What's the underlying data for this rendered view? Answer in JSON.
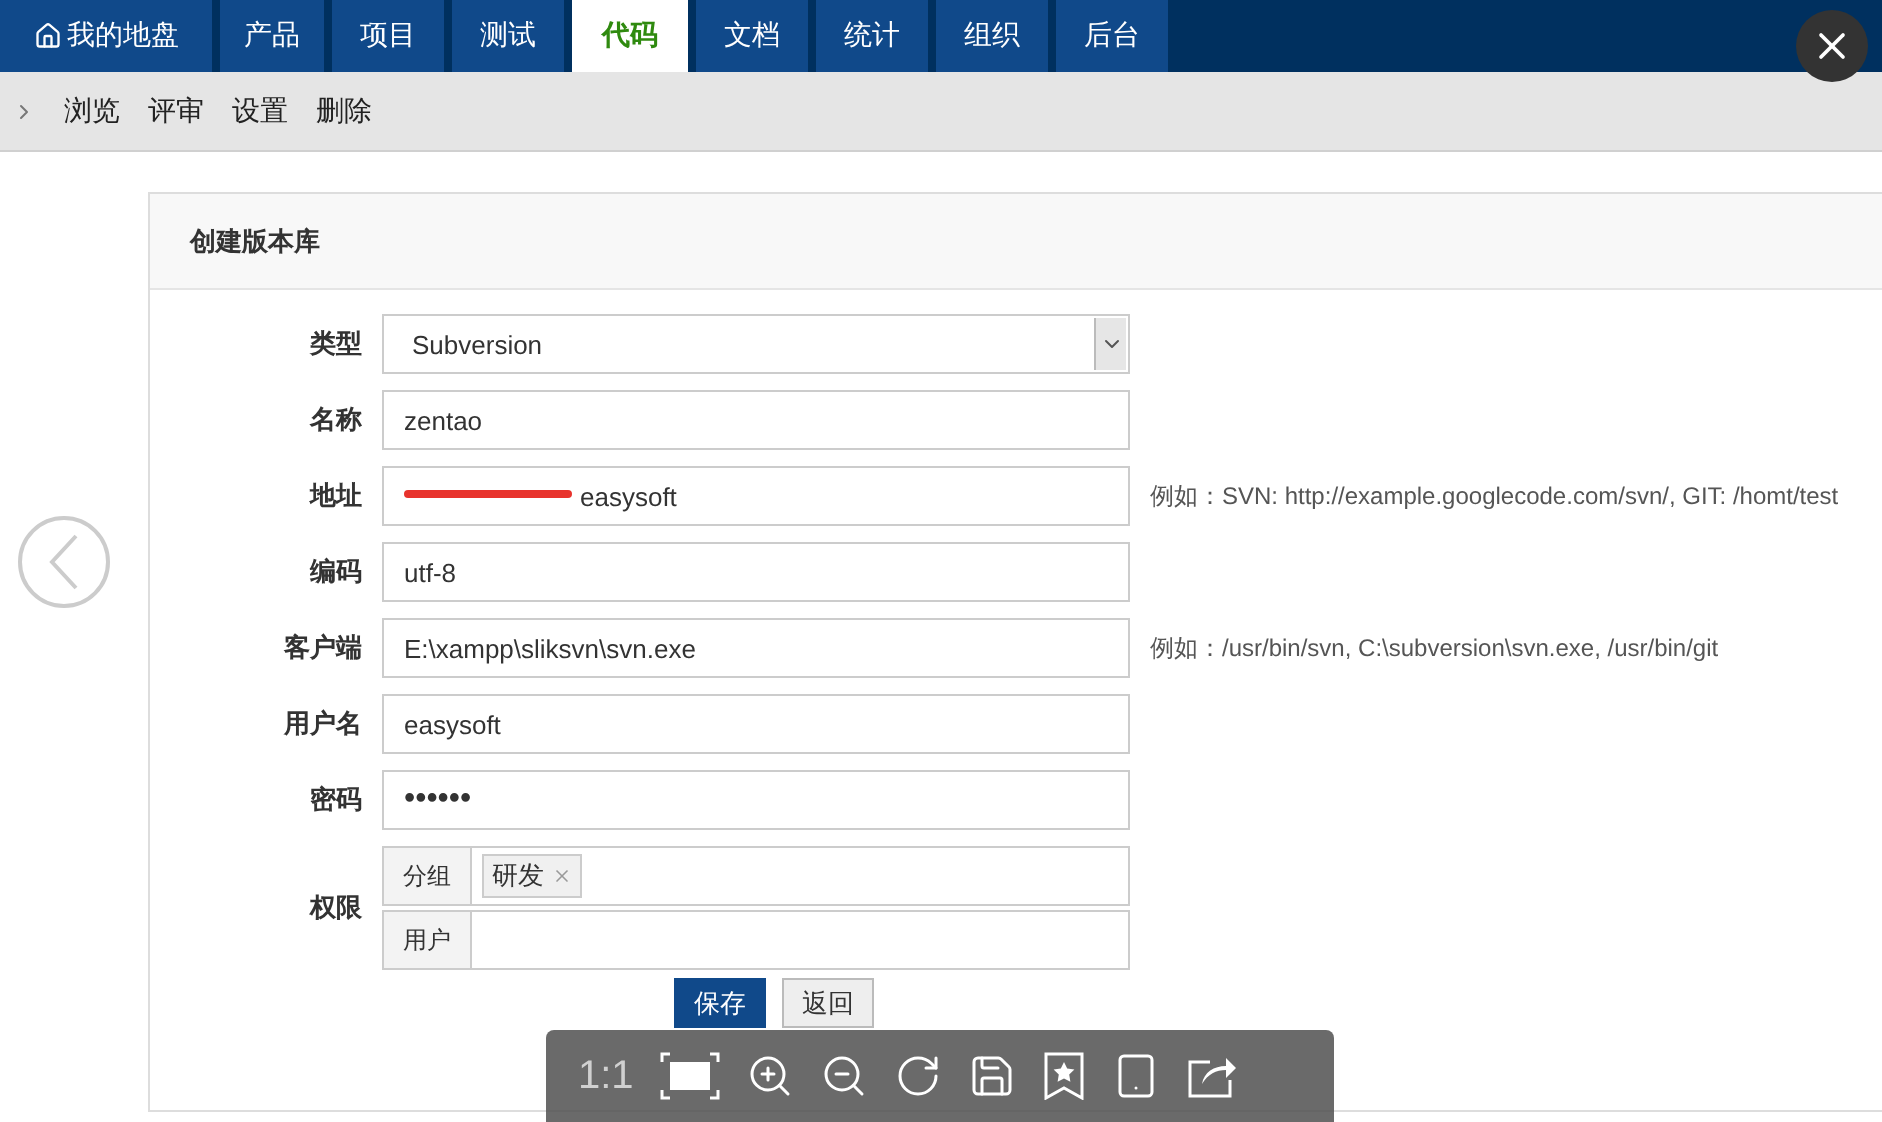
{
  "nav": {
    "tabs": [
      {
        "label": "我的地盘",
        "kind": "home",
        "selected": false
      },
      {
        "label": "产品",
        "kind": "plain",
        "selected": false
      },
      {
        "label": "项目",
        "kind": "plain",
        "selected": false
      },
      {
        "label": "测试",
        "kind": "plain",
        "selected": false
      },
      {
        "label": "代码",
        "kind": "plain",
        "selected": true
      },
      {
        "label": "文档",
        "kind": "plain",
        "selected": false
      },
      {
        "label": "统计",
        "kind": "plain",
        "selected": false
      },
      {
        "label": "组织",
        "kind": "plain",
        "selected": false
      },
      {
        "label": "后台",
        "kind": "plain",
        "selected": false
      }
    ]
  },
  "subnav": {
    "items": [
      "浏览",
      "评审",
      "设置",
      "删除"
    ]
  },
  "form": {
    "title": "创建版本库",
    "fields": [
      {
        "label": "类型",
        "kind": "select",
        "value": "Subversion"
      },
      {
        "label": "名称",
        "kind": "text",
        "value": "zentao"
      },
      {
        "label": "地址",
        "kind": "redacted",
        "value": "easysoft",
        "hint": "例如：SVN: http://example.googlecode.com/svn/, GIT: /homt/test"
      },
      {
        "label": "编码",
        "kind": "text",
        "value": "utf-8"
      },
      {
        "label": "客户端",
        "kind": "text",
        "value": "E:\\xampp\\sliksvn\\svn.exe",
        "hint": "例如：/usr/bin/svn, C:\\subversion\\svn.exe, /usr/bin/git"
      },
      {
        "label": "用户名",
        "kind": "text",
        "value": "easysoft"
      },
      {
        "label": "密码",
        "kind": "password",
        "value": "••••••"
      },
      {
        "label": "权限",
        "kind": "permissions",
        "rows": [
          {
            "label": "分组",
            "tags": [
              "研发"
            ]
          },
          {
            "label": "用户",
            "tags": []
          }
        ]
      }
    ],
    "buttons": [
      {
        "label": "保存",
        "kind": "primary"
      },
      {
        "label": "返回",
        "kind": "default"
      }
    ]
  },
  "viewer": {
    "zoom_label": "1:1"
  }
}
